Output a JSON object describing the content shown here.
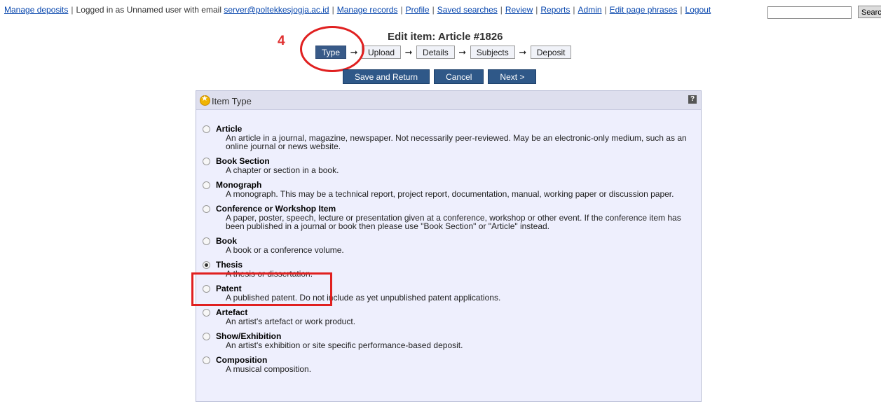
{
  "topbar": {
    "manage_deposits": "Manage deposits",
    "logged_in_prefix": "Logged in as Unnamed user with email",
    "email": "server@poltekkesjogja.ac.id",
    "links": [
      "Manage records",
      "Profile",
      "Saved searches",
      "Review",
      "Reports",
      "Admin",
      "Edit page phrases",
      "Logout"
    ],
    "search_label": "Search"
  },
  "page": {
    "title": "Edit item: Article #1826",
    "annotation_number": "4"
  },
  "wizard": {
    "steps": [
      "Type",
      "Upload",
      "Details",
      "Subjects",
      "Deposit"
    ],
    "active_index": 0
  },
  "actions": {
    "save_return": "Save and Return",
    "cancel": "Cancel",
    "next": "Next >"
  },
  "panel": {
    "title": "Item Type",
    "help": "?"
  },
  "item_types": [
    {
      "name": "Article",
      "desc": "An article in a journal, magazine, newspaper. Not necessarily peer-reviewed. May be an electronic-only medium, such as an online journal or news website.",
      "checked": false
    },
    {
      "name": "Book Section",
      "desc": "A chapter or section in a book.",
      "checked": false
    },
    {
      "name": "Monograph",
      "desc": "A monograph. This may be a technical report, project report, documentation, manual, working paper or discussion paper.",
      "checked": false
    },
    {
      "name": "Conference or Workshop Item",
      "desc": "A paper, poster, speech, lecture or presentation given at a conference, workshop or other event. If the conference item has been published in a journal or book then please use \"Book Section\" or \"Article\" instead.",
      "checked": false
    },
    {
      "name": "Book",
      "desc": "A book or a conference volume.",
      "checked": false
    },
    {
      "name": "Thesis",
      "desc": "A thesis or dissertation.",
      "checked": true
    },
    {
      "name": "Patent",
      "desc": "A published patent. Do not include as yet unpublished patent applications.",
      "checked": false
    },
    {
      "name": "Artefact",
      "desc": "An artist's artefact or work product.",
      "checked": false
    },
    {
      "name": "Show/Exhibition",
      "desc": "An artist's exhibition or site specific performance-based deposit.",
      "checked": false
    },
    {
      "name": "Composition",
      "desc": "A musical composition.",
      "checked": false
    }
  ]
}
